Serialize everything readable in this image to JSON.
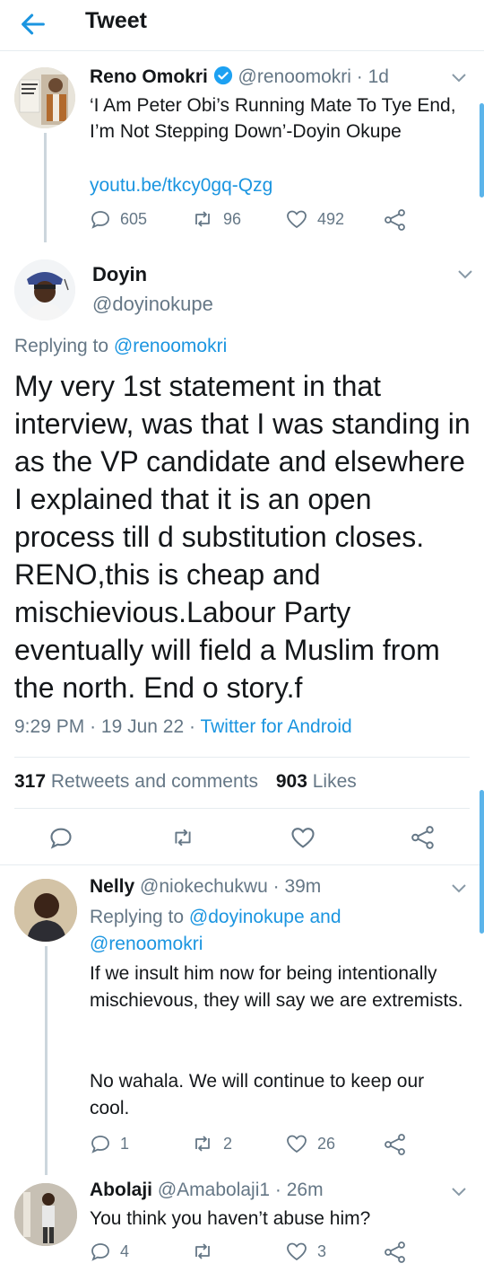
{
  "header": {
    "title": "Tweet"
  },
  "tweet1": {
    "name": "Reno Omokri",
    "handle": "@renoomokri",
    "time": "· 1d",
    "text": "‘I Am Peter Obi’s Running Mate To Tye End, I’m Not Stepping Down’-Doyin Okupe",
    "link": "youtu.be/tkcy0gq-Qzg",
    "replies": "605",
    "retweets": "96",
    "likes": "492"
  },
  "main": {
    "name": "Doyin",
    "handle": "@doyinokupe",
    "replying_prefix": "Replying to",
    "replying_to": "@renoomokri",
    "text": "My very 1st statement in that interview, was that I was standing in as the VP candidate and elsewhere I explained that it is an open process till d substitution closes. RENO,this is cheap and mischievious.Labour Party eventually will field a Muslim from the  north. End o story.f",
    "time": "9:29 PM",
    "date": "19 Jun 22",
    "source": "Twitter for Android",
    "retweets_count": "317",
    "retweets_label": "Retweets and comments",
    "likes_count": "903",
    "likes_label": "Likes"
  },
  "reply1": {
    "name": "Nelly",
    "handle": "@niokechukwu",
    "time": "· 39m",
    "replying_prefix": "Replying to",
    "replying_to_1": "@doyinokupe",
    "replying_and": "and",
    "replying_to_2": "@renoomokri",
    "text1": "If we insult him now for being intentionally mischievous, they will say we are extremists.",
    "text2": "No wahala. We will continue to keep our cool.",
    "replies": "1",
    "retweets": "2",
    "likes": "26"
  },
  "reply2": {
    "name": "Abolaji",
    "handle": "@Amabolaji1",
    "time": "· 26m",
    "text": "You think you haven’t abuse him?",
    "replies": "4",
    "retweets": "",
    "likes": "3"
  },
  "colors": {
    "accent": "#1b95e0",
    "muted": "#657786",
    "verified": "#1da1f2"
  }
}
